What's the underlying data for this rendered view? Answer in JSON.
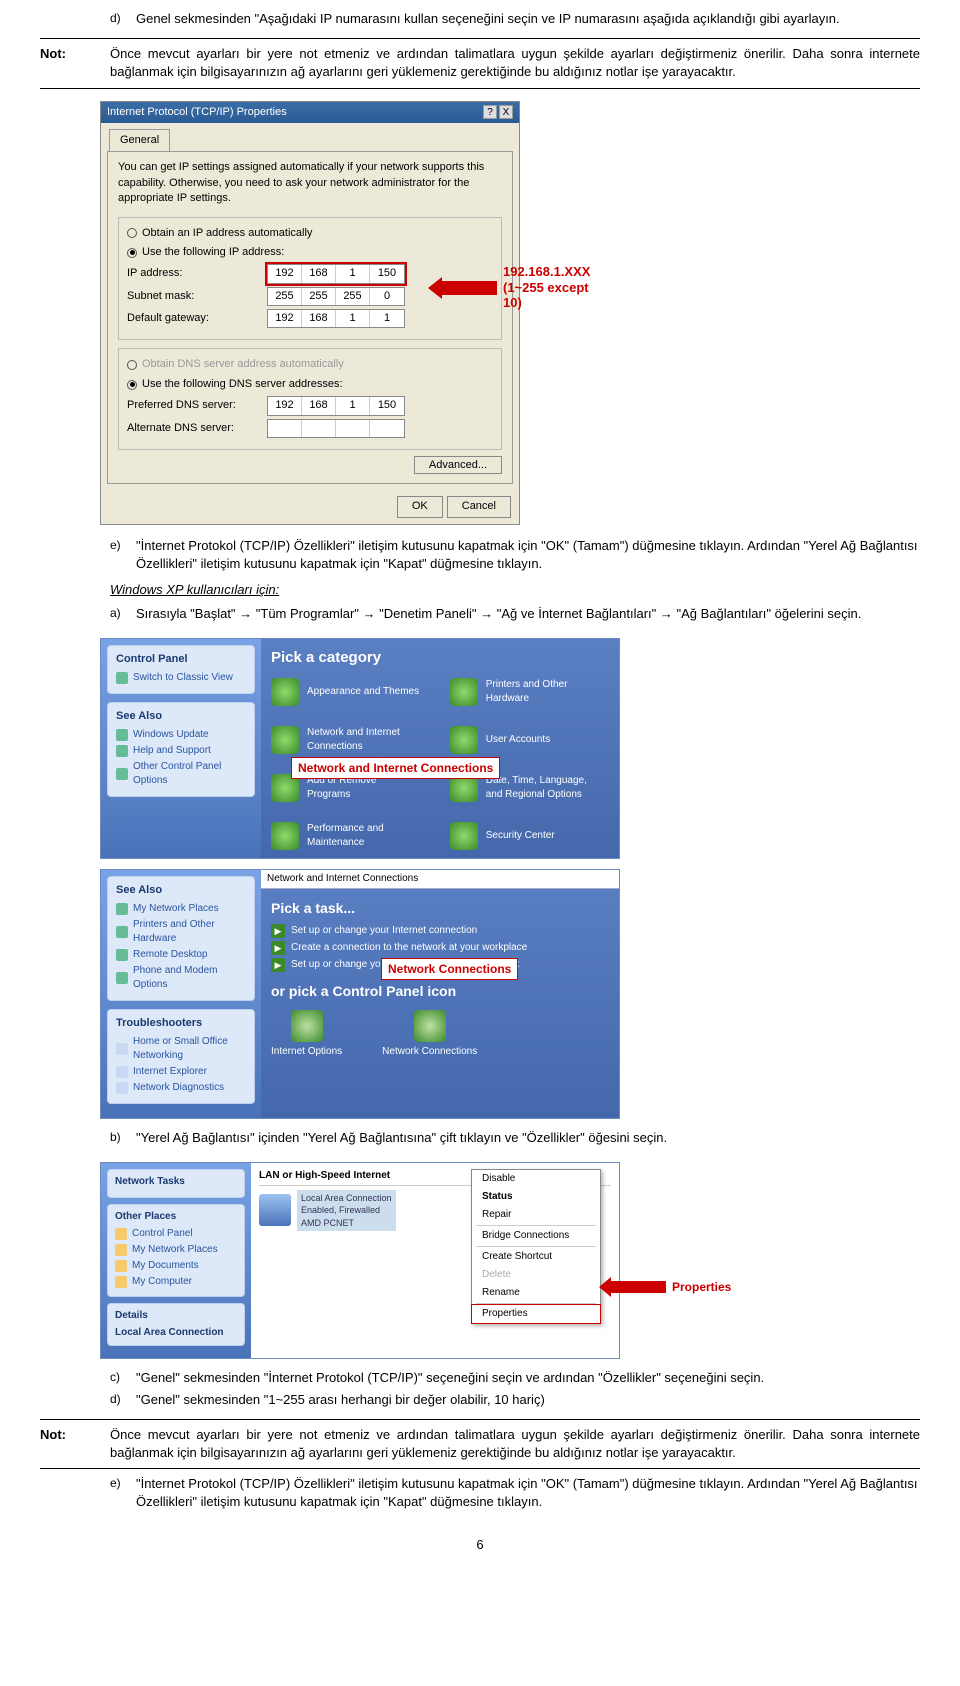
{
  "top": {
    "item_d_letter": "d)",
    "item_d_text": "Genel sekmesinden \"Aşağıdaki IP numarasını kullan seçeneğini seçin ve IP numarasını aşağıda açıklandığı gibi ayarlayın."
  },
  "note1": {
    "label": "Not:",
    "text": "Önce mevcut ayarları bir yere not etmeniz ve ardından talimatlara uygun şekilde ayarları değiştirmeniz önerilir. Daha sonra internete bağlanmak için bilgisayarınızın ağ ayarlarını geri yüklemeniz gerektiğinde bu aldığınız notlar işe yarayacaktır."
  },
  "tcpip": {
    "title": "Internet Protocol (TCP/IP) Properties",
    "help": "?",
    "close": "X",
    "tab_general": "General",
    "desc": "You can get IP settings assigned automatically if your network supports this capability. Otherwise, you need to ask your network administrator for the appropriate IP settings.",
    "r_auto_ip": "Obtain an IP address automatically",
    "r_use_ip": "Use the following IP address:",
    "lbl_ip": "IP address:",
    "val_ip": [
      "192",
      "168",
      "1",
      "150"
    ],
    "lbl_mask": "Subnet mask:",
    "val_mask": [
      "255",
      "255",
      "255",
      "0"
    ],
    "lbl_gw": "Default gateway:",
    "val_gw": [
      "192",
      "168",
      "1",
      "1"
    ],
    "r_auto_dns": "Obtain DNS server address automatically",
    "r_use_dns": "Use the following DNS server addresses:",
    "lbl_pdns": "Preferred DNS server:",
    "val_pdns": [
      "192",
      "168",
      "1",
      "150"
    ],
    "lbl_adns": "Alternate DNS server:",
    "btn_adv": "Advanced...",
    "btn_ok": "OK",
    "btn_cancel": "Cancel",
    "callout_l1": "192.168.1.XXX",
    "callout_l2": "(1~255 except 10)"
  },
  "mid": {
    "item_e_letter": "e)",
    "item_e_text": "\"İnternet Protokol (TCP/IP) Özellikleri\" iletişim kutusunu kapatmak için \"OK\" (Tamam\") düğmesine tıklayın. Ardından \"Yerel Ağ Bağlantısı Özellikleri\" iletişim kutusunu kapatmak için \"Kapat\" düğmesine tıklayın.",
    "xp_heading": "Windows XP kullanıcıları için:",
    "item_a_letter": "a)",
    "item_a_text": "Sırasıyla \"Başlat\" → \"Tüm Programlar\" → \"Denetim Paneli\" → \"Ağ ve İnternet Bağlantıları\" → \"Ağ Bağlantıları\" öğelerini seçin."
  },
  "cp1": {
    "side_title": "Control Panel",
    "side_switch": "Switch to Classic View",
    "seealso": "See Also",
    "sa_items": [
      "Windows Update",
      "Help and Support",
      "Other Control Panel Options"
    ],
    "pick_cat": "Pick a category",
    "cats": [
      "Appearance and Themes",
      "Printers and Other Hardware",
      "Network and Internet Connections",
      "User Accounts",
      "Add or Remove Programs",
      "Date, Time, Language, and Regional Options",
      "Performance and Maintenance",
      "Security Center"
    ],
    "callout": "Network and Internet Connections"
  },
  "cp2": {
    "crumb": "Network and Internet Connections",
    "seealso": "See Also",
    "sa_items": [
      "My Network Places",
      "Printers and Other Hardware",
      "Remote Desktop",
      "Phone and Modem Options"
    ],
    "tshoot": "Troubleshooters",
    "ts_items": [
      "Home or Small Office Networking",
      "Internet Explorer",
      "Network Diagnostics"
    ],
    "pick_task": "Pick a task...",
    "tasks": [
      "Set up or change your Internet connection",
      "Create a connection to the network at your workplace",
      "Set up or change your home or small office network"
    ],
    "or_cp": "or pick a Control Panel icon",
    "icons": [
      "Internet Options",
      "Network Connections"
    ],
    "callout": "Network Connections"
  },
  "item_b": {
    "letter": "b)",
    "text": "\"Yerel Ağ Bağlantısı\" içinden \"Yerel Ağ Bağlantısına\" çift tıklayın ve \"Özellikler\" öğesini seçin."
  },
  "lan": {
    "ntasks": "Network Tasks",
    "other": "Other Places",
    "op_items": [
      "Control Panel",
      "My Network Places",
      "My Documents",
      "My Computer"
    ],
    "details": "Details",
    "details_l1": "Local Area Connection",
    "grp_hdr": "LAN or High-Speed Internet",
    "conn_l1": "Local Area Connection",
    "conn_l2": "Enabled, Firewalled",
    "conn_l3": "AMD PCNET",
    "menu": [
      "Disable",
      "Status",
      "Repair",
      "Bridge Connections",
      "Create Shortcut",
      "Delete",
      "Rename",
      "Properties"
    ],
    "callout": "Properties"
  },
  "bottom": {
    "item_c_letter": "c)",
    "item_c_text": "\"Genel\" sekmesinden \"İnternet Protokol (TCP/IP)\" seçeneğini seçin ve ardından \"Özellikler\" seçeneğini seçin.",
    "item_d_letter": "d)",
    "item_d_text": "\"Genel\" sekmesinden \"1~255 arası herhangi bir değer olabilir, 10 hariç)"
  },
  "note2": {
    "label": "Not:",
    "text": "Önce mevcut ayarları bir yere not etmeniz ve ardından talimatlara uygun şekilde ayarları değiştirmeniz önerilir. Daha sonra internete bağlanmak için bilgisayarınızın ağ ayarlarını geri yüklemeniz gerektiğinde bu aldığınız notlar işe yarayacaktır."
  },
  "item_e2": {
    "letter": "e)",
    "text": "\"İnternet Protokol (TCP/IP) Özellikleri\" iletişim kutusunu kapatmak için \"OK\" (Tamam\") düğmesine tıklayın. Ardından \"Yerel Ağ Bağlantısı Özellikleri\" iletişim kutusunu kapatmak için \"Kapat\" düğmesine tıklayın."
  },
  "page_number": "6"
}
